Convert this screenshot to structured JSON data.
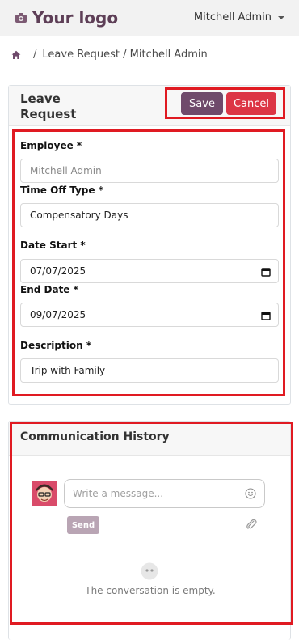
{
  "navbar": {
    "logo": "Your logo",
    "user": "Mitchell Admin"
  },
  "breadcrumb": {
    "sep": "/",
    "items": [
      "Leave Request / Mitchell Admin"
    ]
  },
  "form": {
    "title": "Leave Request",
    "save_label": "Save",
    "cancel_label": "Cancel",
    "fields": {
      "employee": {
        "label": "Employee *",
        "value": "Mitchell Admin"
      },
      "time_off_type": {
        "label": "Time Off Type *",
        "value": "Compensatory Days"
      },
      "date_start": {
        "label": "Date Start *",
        "value": "07/07/2025"
      },
      "end_date": {
        "label": "End Date *",
        "value": "09/07/2025"
      },
      "description": {
        "label": "Description *",
        "value": "Trip with Family"
      }
    }
  },
  "chat": {
    "title": "Communication History",
    "placeholder": "Write a message...",
    "send_label": "Send",
    "empty_text": "The conversation is empty."
  },
  "colors": {
    "brand": "#6f4a6b",
    "danger": "#dc3545",
    "highlight": "#e01a22"
  }
}
